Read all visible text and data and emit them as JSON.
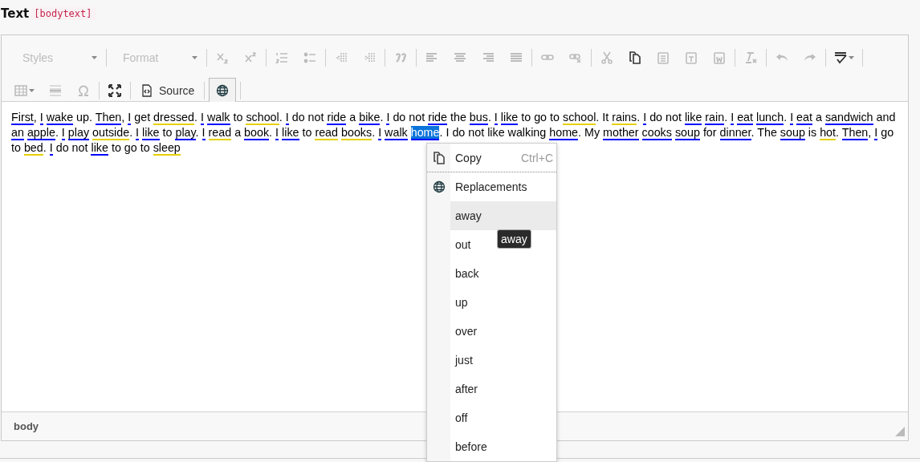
{
  "field": {
    "label": "Text",
    "key": "[bodytext]"
  },
  "toolbar": {
    "rows": [
      [
        [
          {
            "kind": "combo",
            "label": "Styles",
            "disabled": true
          }
        ],
        [
          {
            "kind": "combo",
            "label": "Format",
            "disabled": true
          }
        ],
        [
          {
            "kind": "button",
            "disabled": true
          },
          {
            "kind": "button",
            "disabled": true
          }
        ],
        [
          {
            "kind": "button",
            "disabled": true
          },
          {
            "kind": "button",
            "disabled": true
          }
        ],
        [
          {
            "kind": "button",
            "disabled": true
          },
          {
            "kind": "button",
            "disabled": true
          }
        ],
        [
          {
            "kind": "button",
            "disabled": true
          }
        ],
        [
          {
            "kind": "button",
            "disabled": true
          },
          {
            "kind": "button",
            "disabled": true
          },
          {
            "kind": "button",
            "disabled": true
          },
          {
            "kind": "button",
            "disabled": true
          }
        ],
        [
          {
            "kind": "button",
            "disabled": true
          },
          {
            "kind": "button",
            "disabled": true
          }
        ],
        [
          {
            "kind": "button",
            "disabled": true
          },
          {
            "kind": "button",
            "disabled": false
          },
          {
            "kind": "button",
            "disabled": true
          },
          {
            "kind": "button",
            "disabled": true
          },
          {
            "kind": "button",
            "disabled": true
          }
        ],
        [
          {
            "kind": "button",
            "disabled": true
          }
        ],
        [
          {
            "kind": "button",
            "disabled": true
          },
          {
            "kind": "button",
            "disabled": true
          }
        ],
        [
          {
            "kind": "button",
            "disabled": false,
            "dropdown": true
          }
        ]
      ],
      [
        [
          {
            "kind": "button",
            "disabled": true,
            "dropdown": true
          },
          {
            "kind": "button",
            "disabled": true
          },
          {
            "kind": "button",
            "disabled": true
          }
        ],
        [
          {
            "kind": "button",
            "disabled": false
          }
        ],
        [
          {
            "kind": "button",
            "disabled": false,
            "label": "Source"
          }
        ],
        [
          {
            "kind": "button",
            "disabled": false,
            "on": true
          }
        ]
      ]
    ]
  },
  "content": [
    {
      "text": "First",
      "color": "#0000ff",
      "selected": false,
      "after": ", "
    },
    {
      "text": "I",
      "color": "#0000ff",
      "selected": false
    },
    {
      "text": "wake",
      "color": "#0000ff",
      "selected": false,
      "after": " up. "
    },
    {
      "text": "Then",
      "color": "#0000ff",
      "selected": false,
      "after": ", "
    },
    {
      "text": "I",
      "color": "#0000ff",
      "selected": false,
      "after": " get "
    },
    {
      "text": "dressed",
      "color": "#e6d000",
      "selected": false,
      "after": ". "
    },
    {
      "text": "I",
      "color": "#0000ff",
      "selected": false
    },
    {
      "text": "walk",
      "color": "#0000ff",
      "selected": false,
      "after": " to "
    },
    {
      "text": "school",
      "color": "#e6d000",
      "selected": false,
      "after": ". "
    },
    {
      "text": "I",
      "color": "#0000ff",
      "selected": false,
      "after": " do not "
    },
    {
      "text": "ride",
      "color": "#0000ff",
      "selected": false,
      "after": " a "
    },
    {
      "text": "bike",
      "color": "#0000ff",
      "selected": false,
      "after": ". "
    },
    {
      "text": "I",
      "color": "#0000ff",
      "selected": false,
      "after": " do not "
    },
    {
      "text": "ride",
      "color": "#0000ff",
      "selected": false,
      "after": " the "
    },
    {
      "text": "bus",
      "color": "#0000ff",
      "selected": false,
      "after": ". "
    },
    {
      "text": "I",
      "color": "#0000ff",
      "selected": false
    },
    {
      "text": "like",
      "color": "#0000ff",
      "selected": false,
      "after": " to go to "
    },
    {
      "text": "school",
      "color": "#e6d000",
      "selected": false,
      "after": ". It "
    },
    {
      "text": "rains",
      "color": "#e6d000",
      "selected": false,
      "after": ". "
    },
    {
      "text": "I",
      "color": "#0000ff",
      "selected": false,
      "after": " do not "
    },
    {
      "text": "like",
      "color": "#0000ff",
      "selected": false
    },
    {
      "text": "rain",
      "color": "#0000ff",
      "selected": false,
      "after": ". "
    },
    {
      "text": "I",
      "color": "#0000ff",
      "selected": false
    },
    {
      "text": "eat",
      "color": "#0000ff",
      "selected": false
    },
    {
      "text": "lunch",
      "color": "#0000ff",
      "selected": false,
      "after": ". "
    },
    {
      "text": "I",
      "color": "#0000ff",
      "selected": false
    },
    {
      "text": "eat",
      "color": "#0000ff",
      "selected": false,
      "after": " a "
    },
    {
      "text": "sandwich",
      "color": "#0000ff",
      "selected": false,
      "after": " and "
    },
    {
      "text": "an",
      "color": "#0000ff",
      "selected": false
    },
    {
      "text": "apple",
      "color": "#0000ff",
      "selected": false,
      "after": ". "
    },
    {
      "text": "I",
      "color": "#0000ff",
      "selected": false
    },
    {
      "text": "play",
      "color": "#0000ff",
      "selected": false
    },
    {
      "text": "outside",
      "color": "#e6d000",
      "selected": false,
      "after": ". "
    },
    {
      "text": "I",
      "color": "#0000ff",
      "selected": false
    },
    {
      "text": "like",
      "color": "#0000ff",
      "selected": false,
      "after": " to "
    },
    {
      "text": "play",
      "color": "#0000ff",
      "selected": false,
      "after": ". "
    },
    {
      "text": "I",
      "color": "#0000ff",
      "selected": false
    },
    {
      "text": "read",
      "color": "#e6d000",
      "selected": false,
      "after": " a "
    },
    {
      "text": "book",
      "color": "#0000ff",
      "selected": false,
      "after": ". "
    },
    {
      "text": "I",
      "color": "#0000ff",
      "selected": false
    },
    {
      "text": "like",
      "color": "#0000ff",
      "selected": false,
      "after": " to "
    },
    {
      "text": "read",
      "color": "#e6d000",
      "selected": false
    },
    {
      "text": "books",
      "color": "#e6d000",
      "selected": false,
      "after": ". "
    },
    {
      "text": "I",
      "color": "#0000ff",
      "selected": false
    },
    {
      "text": "walk",
      "color": "#0000ff",
      "selected": false
    },
    {
      "text": "home",
      "color": "#0000ff",
      "selected": true,
      "after": ". I do not like walking "
    },
    {
      "text": "home",
      "color": "#0000ff",
      "selected": false,
      "after": ". My "
    },
    {
      "text": "mother",
      "color": "#0000ff",
      "selected": false
    },
    {
      "text": "cooks",
      "color": "#0000ff",
      "selected": false
    },
    {
      "text": "soup",
      "color": "#0000ff",
      "selected": false,
      "after": " for "
    },
    {
      "text": "dinner",
      "color": "#0000ff",
      "selected": false,
      "after": ". The "
    },
    {
      "text": "soup",
      "color": "#0000ff",
      "selected": false,
      "after": " is "
    },
    {
      "text": "hot",
      "color": "#e6d000",
      "selected": false,
      "after": ". "
    },
    {
      "text": "Then",
      "color": "#0000ff",
      "selected": false,
      "after": ", "
    },
    {
      "text": "I",
      "color": "#0000ff",
      "selected": false,
      "after": " go to "
    },
    {
      "text": "bed",
      "color": "#e6d000",
      "selected": false,
      "after": ". "
    },
    {
      "text": "I",
      "color": "#0000ff",
      "selected": false,
      "after": " do not "
    },
    {
      "text": "like",
      "color": "#0000ff",
      "selected": false,
      "after": " to go to "
    },
    {
      "text": "sleep",
      "color": "#e6d000",
      "selected": false
    }
  ],
  "context_menu": {
    "items": [
      {
        "kind": "command",
        "label": "Copy",
        "shortcut": "Ctrl+C"
      },
      {
        "kind": "group",
        "label": "Replacements"
      },
      {
        "kind": "option",
        "label": "away",
        "hovered": true
      },
      {
        "kind": "option",
        "label": "out",
        "hovered": false
      },
      {
        "kind": "option",
        "label": "back",
        "hovered": false
      },
      {
        "kind": "option",
        "label": "up",
        "hovered": false
      },
      {
        "kind": "option",
        "label": "over",
        "hovered": false
      },
      {
        "kind": "option",
        "label": "just",
        "hovered": false
      },
      {
        "kind": "option",
        "label": "after",
        "hovered": false
      },
      {
        "kind": "option",
        "label": "off",
        "hovered": false
      },
      {
        "kind": "option",
        "label": "before",
        "hovered": false
      }
    ],
    "tooltip": "away"
  },
  "status_bar": {
    "path": "body"
  }
}
